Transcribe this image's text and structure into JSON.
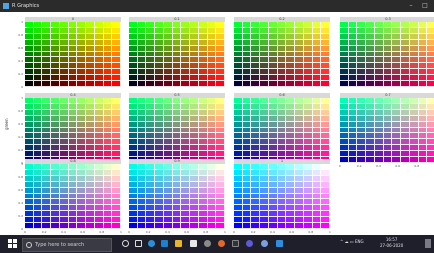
{
  "window": {
    "title": "R Graphics",
    "minimize": "–",
    "maximize": "□"
  },
  "plot": {
    "facets": [
      "0",
      "0.1",
      "0.2",
      "0.3",
      "0.4",
      "0.5",
      "0.6",
      "0.7",
      "0.8",
      "0.9",
      "1"
    ],
    "ylabel": "green",
    "yticks": [
      "0",
      "0.2",
      "0.4",
      "0.6",
      "0.8",
      "1"
    ],
    "xticks": [
      "0",
      "0.2",
      "0.4",
      "0.6",
      "0.8",
      "1"
    ],
    "grid_size": 11
  },
  "taskbar": {
    "search_placeholder": "Type here to search",
    "tray": {
      "symbols": "^ ☁ ▭ ENG",
      "time": "16:57",
      "date": "27-06-2020"
    },
    "pinned_icons": [
      "task-view-icon",
      "edge-icon",
      "mail-icon",
      "file-explorer-icon",
      "store-icon",
      "settings-icon",
      "photos-icon",
      "chrome-icon",
      "terminal-icon",
      "slack-icon",
      "vscode-icon"
    ]
  },
  "colors": {
    "titlebar": "#2b2b2b",
    "taskbar": "#1f1f2b",
    "strip": "#d9d9d9"
  }
}
